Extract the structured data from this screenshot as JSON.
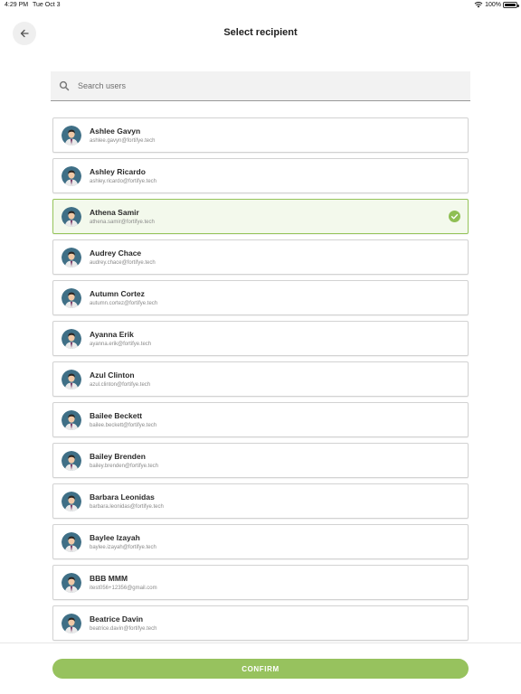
{
  "status_bar": {
    "time": "4:29 PM",
    "date": "Tue Oct 3",
    "battery": "100%"
  },
  "header": {
    "title": "Select recipient",
    "back_icon": "arrow-left-icon"
  },
  "search": {
    "placeholder": "Search users",
    "value": "",
    "icon": "search-icon"
  },
  "users": [
    {
      "name": "Ashlee Gavyn",
      "email": "ashlee.gavyn@fortifye.tech",
      "selected": false
    },
    {
      "name": "Ashley Ricardo",
      "email": "ashley.ricardo@fortifye.tech",
      "selected": false
    },
    {
      "name": "Athena Samir",
      "email": "athena.samir@fortifye.tech",
      "selected": true
    },
    {
      "name": "Audrey Chace",
      "email": "audrey.chace@fortifye.tech",
      "selected": false
    },
    {
      "name": "Autumn Cortez",
      "email": "autumn.cortez@fortifye.tech",
      "selected": false
    },
    {
      "name": "Ayanna Erik",
      "email": "ayanna.erik@fortifye.tech",
      "selected": false
    },
    {
      "name": "Azul Clinton",
      "email": "azul.clinton@fortifye.tech",
      "selected": false
    },
    {
      "name": "Bailee Beckett",
      "email": "bailee.beckett@fortifye.tech",
      "selected": false
    },
    {
      "name": "Bailey Brenden",
      "email": "bailey.brenden@fortifye.tech",
      "selected": false
    },
    {
      "name": "Barbara Leonidas",
      "email": "barbara.leonidas@fortifye.tech",
      "selected": false
    },
    {
      "name": "Baylee Izayah",
      "email": "baylee.izayah@fortifye.tech",
      "selected": false
    },
    {
      "name": "BBB MMM",
      "email": "itest056+12356@gmail.com",
      "selected": false
    },
    {
      "name": "Beatrice Davin",
      "email": "beatrice.davin@fortifye.tech",
      "selected": false
    }
  ],
  "footer": {
    "confirm_label": "CONFIRM"
  },
  "colors": {
    "accent": "#97c25e",
    "selected_bg": "#f3f9ec",
    "selected_border": "#95c45a",
    "avatar_bg": "#3f6f86"
  }
}
